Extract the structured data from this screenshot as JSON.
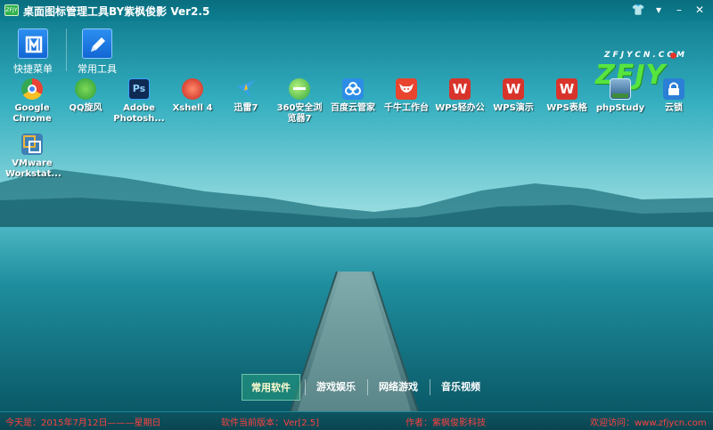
{
  "window": {
    "title": "桌面图标管理工具BY紫枫俊影 Ver2.5",
    "app_icon_text": "ZFJY",
    "controls": [
      "skin-icon",
      "menu-icon",
      "minimize-icon",
      "close-icon"
    ]
  },
  "toolbar": {
    "items": [
      {
        "label": "快捷菜单",
        "icon": "quick-menu-icon"
      },
      {
        "label": "常用工具",
        "icon": "pencil-icon"
      }
    ]
  },
  "logo": {
    "top_text": "ZFJYCN.COM",
    "main_text": "ZFJY"
  },
  "apps": [
    {
      "label": "Google Chrome",
      "icon": "chrome-icon",
      "color": "#e84335"
    },
    {
      "label": "QQ旋风",
      "icon": "qq-whirlwind-icon",
      "color": "#3bb24b"
    },
    {
      "label": "Adobe Photosh...",
      "icon": "photoshop-icon",
      "color": "#0f2b53"
    },
    {
      "label": "Xshell 4",
      "icon": "xshell-icon",
      "color": "#d9322b"
    },
    {
      "label": "迅雷7",
      "icon": "thunder-icon",
      "color": "#3aa0e8"
    },
    {
      "label": "360安全浏览器7",
      "icon": "browser-360-icon",
      "color": "#35b34a"
    },
    {
      "label": "百度云管家",
      "icon": "baidu-cloud-icon",
      "color": "#2d8de6"
    },
    {
      "label": "千牛工作台",
      "icon": "qianniu-icon",
      "color": "#e8442e"
    },
    {
      "label": "WPS轻办公",
      "icon": "wps-icon",
      "color": "#d9342b"
    },
    {
      "label": "WPS演示",
      "icon": "wps-presentation-icon",
      "color": "#d9342b"
    },
    {
      "label": "WPS表格",
      "icon": "wps-spreadsheet-icon",
      "color": "#d9342b"
    },
    {
      "label": "phpStudy",
      "icon": "phpstudy-icon",
      "color": "#3f6d3a"
    },
    {
      "label": "云锁",
      "icon": "cloud-lock-icon",
      "color": "#2b7fd6"
    },
    {
      "label": "VMware Workstat...",
      "icon": "vmware-icon",
      "color": "#3e7fb5"
    }
  ],
  "tabs": [
    {
      "label": "常用软件",
      "active": true
    },
    {
      "label": "游戏娱乐",
      "active": false
    },
    {
      "label": "网络游戏",
      "active": false
    },
    {
      "label": "音乐视频",
      "active": false
    }
  ],
  "status": {
    "date": "今天是：2015年7月12日———星期日",
    "version": "软件当前版本：Ver[2.5]",
    "author": "作者：紫枫俊影科技",
    "website": "欢迎访问：www.zfjycn.com"
  },
  "colors": {
    "status_text": "#ff4040",
    "logo_green": "#56e53f",
    "active_tab_text": "#fffbd0"
  }
}
